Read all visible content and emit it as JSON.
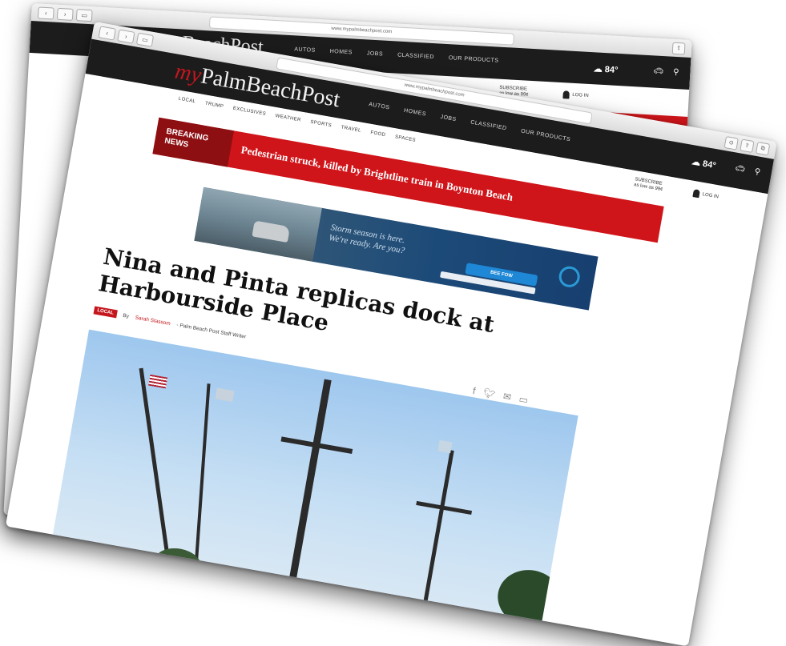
{
  "browser": {
    "url": "www.mypalmbeachpost.com",
    "back_url": "www.mypalmbeachpost.com"
  },
  "site": {
    "logo_prefix": "my",
    "logo_main": "PalmBeachPost",
    "back_logo": "BeachPost",
    "nav": [
      "AUTOS",
      "HOMES",
      "JOBS",
      "CLASSIFIED",
      "OUR PRODUCTS"
    ],
    "weather": "84°",
    "sections": [
      "LOCAL",
      "TRUMP",
      "EXCLUSIVES",
      "WEATHER",
      "SPORTS",
      "TRAVEL",
      "FOOD",
      "SPACES"
    ],
    "subscribe_line1": "SUBSCRIBE",
    "subscribe_line2": "as low as 99¢",
    "login": "LOG IN"
  },
  "breaking": {
    "tag_line1": "BREAKING",
    "tag_line2": "NEWS",
    "text": "Pedestrian struck, killed by Brightline train in Boynton Beach"
  },
  "ad": {
    "line1": "Storm season is here.",
    "line2": "We're ready. Are you?",
    "button": "BEE FOW",
    "sub": ""
  },
  "article": {
    "headline": "Nina and Pinta replicas dock at Harbourside Place",
    "tag": "LOCAL",
    "by": "By",
    "author": "Sarah Stassom",
    "role": "- Palm Beach Post Staff Writer"
  },
  "colors": {
    "brand_red": "#c4161c",
    "header_bg": "#1c1c1c",
    "breaking_red": "#d0151a"
  },
  "icons": [
    "facebook-icon",
    "twitter-icon",
    "email-icon",
    "comment-icon",
    "car-icon",
    "search-icon",
    "user-icon"
  ]
}
